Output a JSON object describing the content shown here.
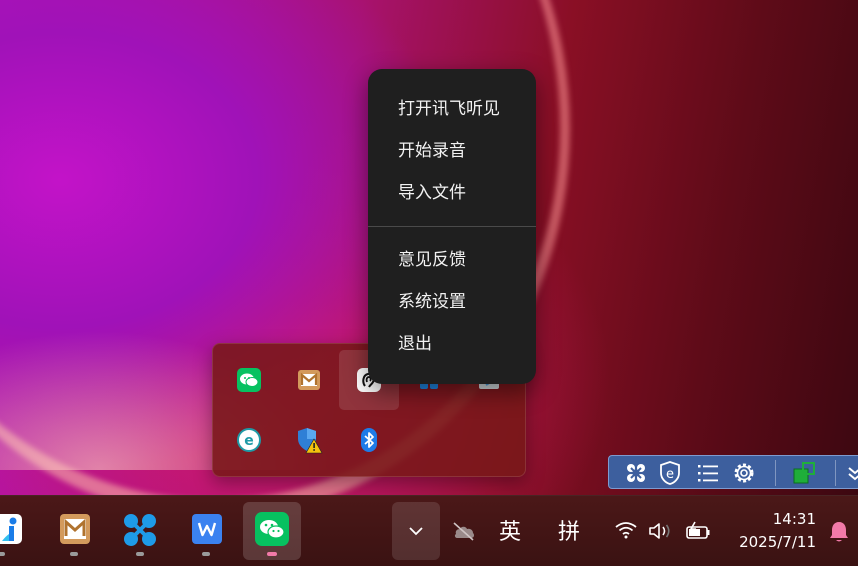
{
  "context_menu": {
    "items": [
      {
        "label": "打开讯飞听见"
      },
      {
        "label": "开始录音"
      },
      {
        "label": "导入文件"
      },
      {
        "label": "意见反馈"
      },
      {
        "label": "系统设置"
      },
      {
        "label": "退出"
      }
    ]
  },
  "tray_flyout": {
    "icons": [
      "wechat-icon",
      "mail-icon",
      "xunfei-tingjian-icon",
      "app-icon-partial",
      "app-icon-partial-2",
      "edge-e-icon",
      "windows-security-warning-icon",
      "bluetooth-icon"
    ]
  },
  "blue_toolbar": {
    "icons": [
      "app-grid-icon",
      "e-shield-icon",
      "list-icon",
      "gear-icon",
      "green-window-icon",
      "chevron-double-down-icon"
    ]
  },
  "taskbar": {
    "apps": [
      "blue-app-icon",
      "mail-app-icon",
      "fourdot-app-icon",
      "wps-icon",
      "wechat-icon"
    ],
    "ime_lang": "英",
    "ime_mode": "拼",
    "clock_time": "14:31",
    "clock_date": "2025/7/11"
  },
  "colors": {
    "menu_bg": "#1f1f1f",
    "menu_text": "#f2f2f2",
    "taskbar_bg": "#3a1212",
    "wechat_green": "#07c160",
    "bluetooth_blue": "#1e7be8",
    "blue_bar": "#3d5f9e",
    "notification_pink": "#f27aa8"
  }
}
